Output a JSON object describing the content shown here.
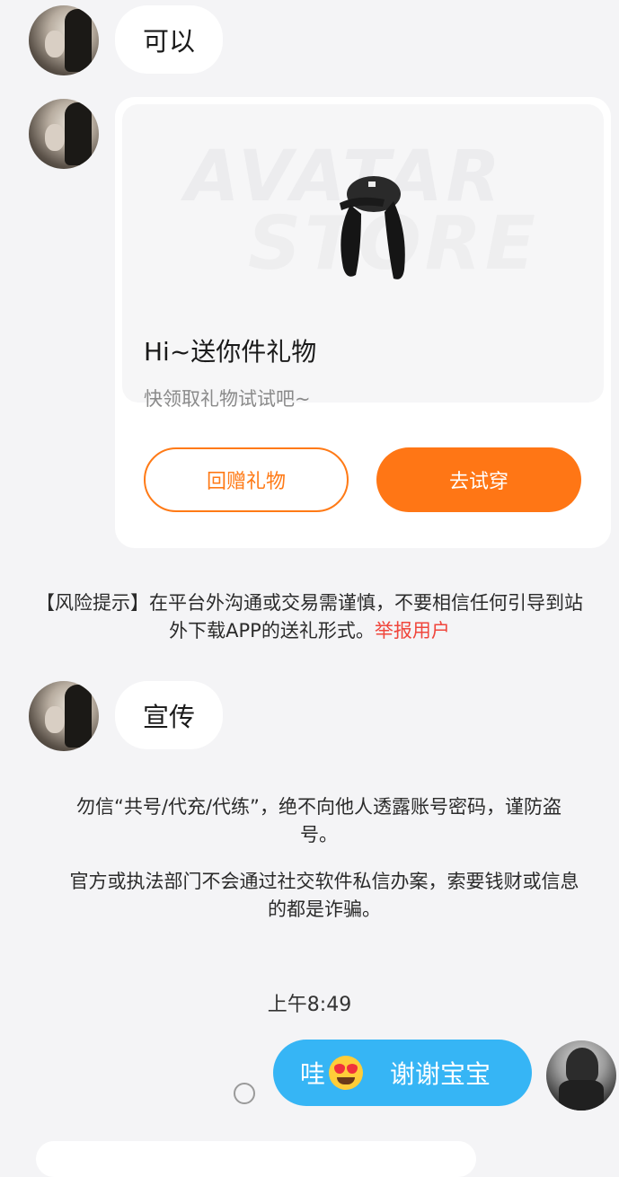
{
  "messages": {
    "msg1": "可以",
    "msg2": "宣传"
  },
  "gift_card": {
    "watermark_line1": "AVATAR",
    "watermark_line2": "STORE",
    "title": "Hi~送你件礼物",
    "subtitle": "快领取礼物试试吧~",
    "return_gift_label": "回赠礼物",
    "try_on_label": "去试穿"
  },
  "risk_notice": {
    "text": "【风险提示】在平台外沟通或交易需谨慎，不要相信任何引导到站外下载APP的送礼形式。",
    "report_link": "举报用户"
  },
  "security_notice": {
    "line1": "勿信“共号/代充/代练”，绝不向他人透露账号密码，谨防盗号。",
    "line2": "官方或执法部门不会通过社交软件私信办案，索要钱财或信息的都是诈骗。"
  },
  "timestamp": "上午8:49",
  "my_message": {
    "prefix": "哇",
    "emoji": "heart-eyes-emoji",
    "suffix": "谢谢宝宝"
  },
  "colors": {
    "accent_orange": "#ff7615",
    "my_bubble_blue": "#36b5f5",
    "report_red": "#f0463c"
  }
}
